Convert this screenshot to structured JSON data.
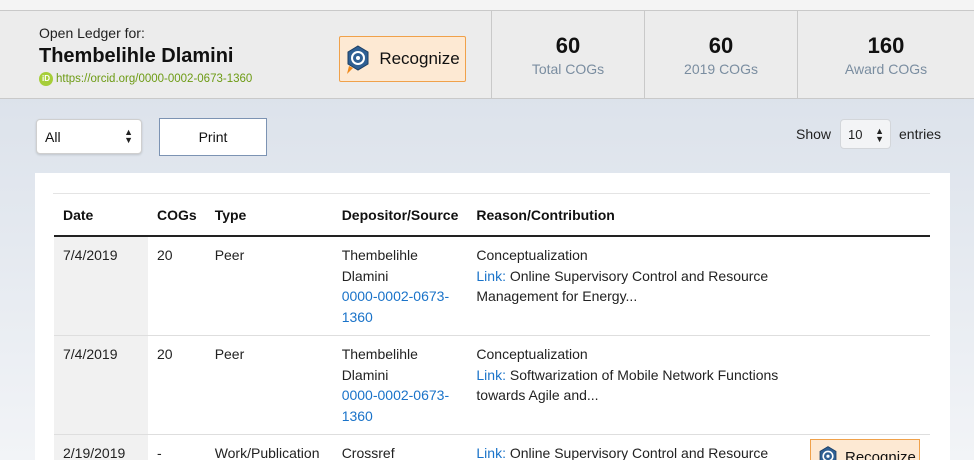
{
  "header": {
    "prefix": "Open Ledger for:",
    "name": "Thembelihle Dlamini",
    "orcid_url": "https://orcid.org/0000-0002-0673-1360",
    "orcid_badge": "iD",
    "recognize_label": "Recognize",
    "stats": [
      {
        "value": "60",
        "label": "Total COGs"
      },
      {
        "value": "60",
        "label": "2019 COGs"
      },
      {
        "value": "160",
        "label": "Award COGs"
      }
    ]
  },
  "controls": {
    "filter_selected": "All",
    "print_label": "Print",
    "show_label": "Show",
    "entries_value": "10",
    "entries_label": "entries"
  },
  "table": {
    "headers": [
      "Date",
      "COGs",
      "Type",
      "Depositor/Source",
      "Reason/Contribution"
    ],
    "rows": [
      {
        "date": "7/4/2019",
        "cogs": "20",
        "type": "Peer",
        "depositor": "Thembelihle Dlamini",
        "depositor_id": "0000-0002-0673-1360",
        "reason": "Conceptualization",
        "link_label": "Link:",
        "link_text": "Online Supervisory Control and Resource Management for Energy..."
      },
      {
        "date": "7/4/2019",
        "cogs": "20",
        "type": "Peer",
        "depositor": "Thembelihle Dlamini",
        "depositor_id": "0000-0002-0673-1360",
        "reason": "Conceptualization",
        "link_label": "Link:",
        "link_text": "Softwarization of Mobile Network Functions towards Agile and..."
      },
      {
        "date": "2/19/2019",
        "cogs": "-",
        "type": "Work/Publication",
        "depositor": "Crossref",
        "depositor_id": "",
        "reason": "",
        "link_label": "Link:",
        "link_text": "Online Supervisory Control and Resource",
        "recognize_label": "Recognize"
      }
    ]
  },
  "colors": {
    "accent_orange": "#f0a14a",
    "link_blue": "#1a73c9",
    "orcid_green": "#a6ce39"
  },
  "icons": [
    "orcid-icon",
    "recognize-badge-icon",
    "select-arrows-icon"
  ]
}
